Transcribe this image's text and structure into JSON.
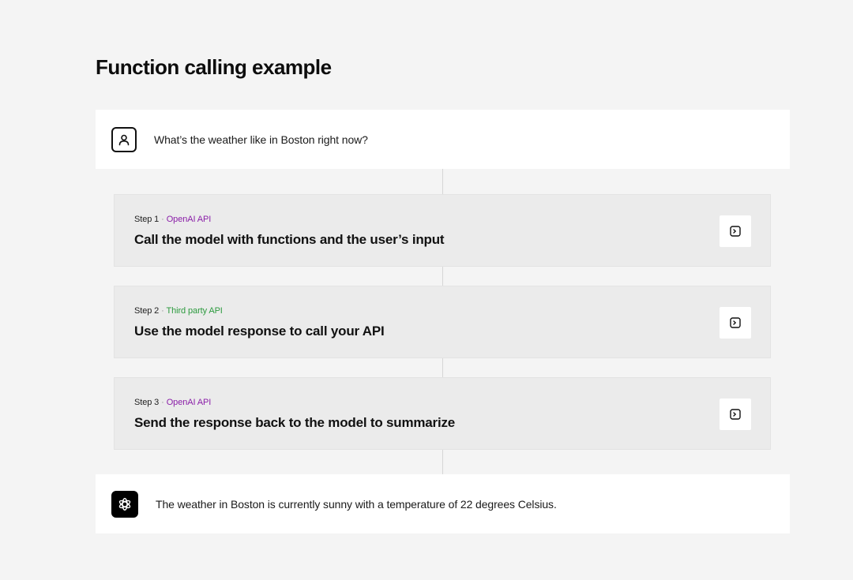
{
  "page": {
    "title": "Function calling example"
  },
  "user_message": {
    "text": "What’s the weather like in Boston right now?",
    "avatar_icon": "user-icon"
  },
  "steps": [
    {
      "step_label": "Step 1",
      "separator": "·",
      "api_label": "OpenAI API",
      "api_color": "#8a1ea8",
      "title": "Call the model with functions and the user’s input",
      "action_icon": "terminal-icon"
    },
    {
      "step_label": "Step 2",
      "separator": "·",
      "api_label": "Third party API",
      "api_color": "#2c9a3e",
      "title": "Use the model response to call your API",
      "action_icon": "terminal-icon"
    },
    {
      "step_label": "Step 3",
      "separator": "·",
      "api_label": "OpenAI API",
      "api_color": "#8a1ea8",
      "title": "Send the response back to the model to summarize",
      "action_icon": "terminal-icon"
    }
  ],
  "assistant_message": {
    "text": "The weather in Boston is currently sunny with a temperature of 22 degrees Celsius.",
    "avatar_icon": "openai-logo-icon"
  }
}
